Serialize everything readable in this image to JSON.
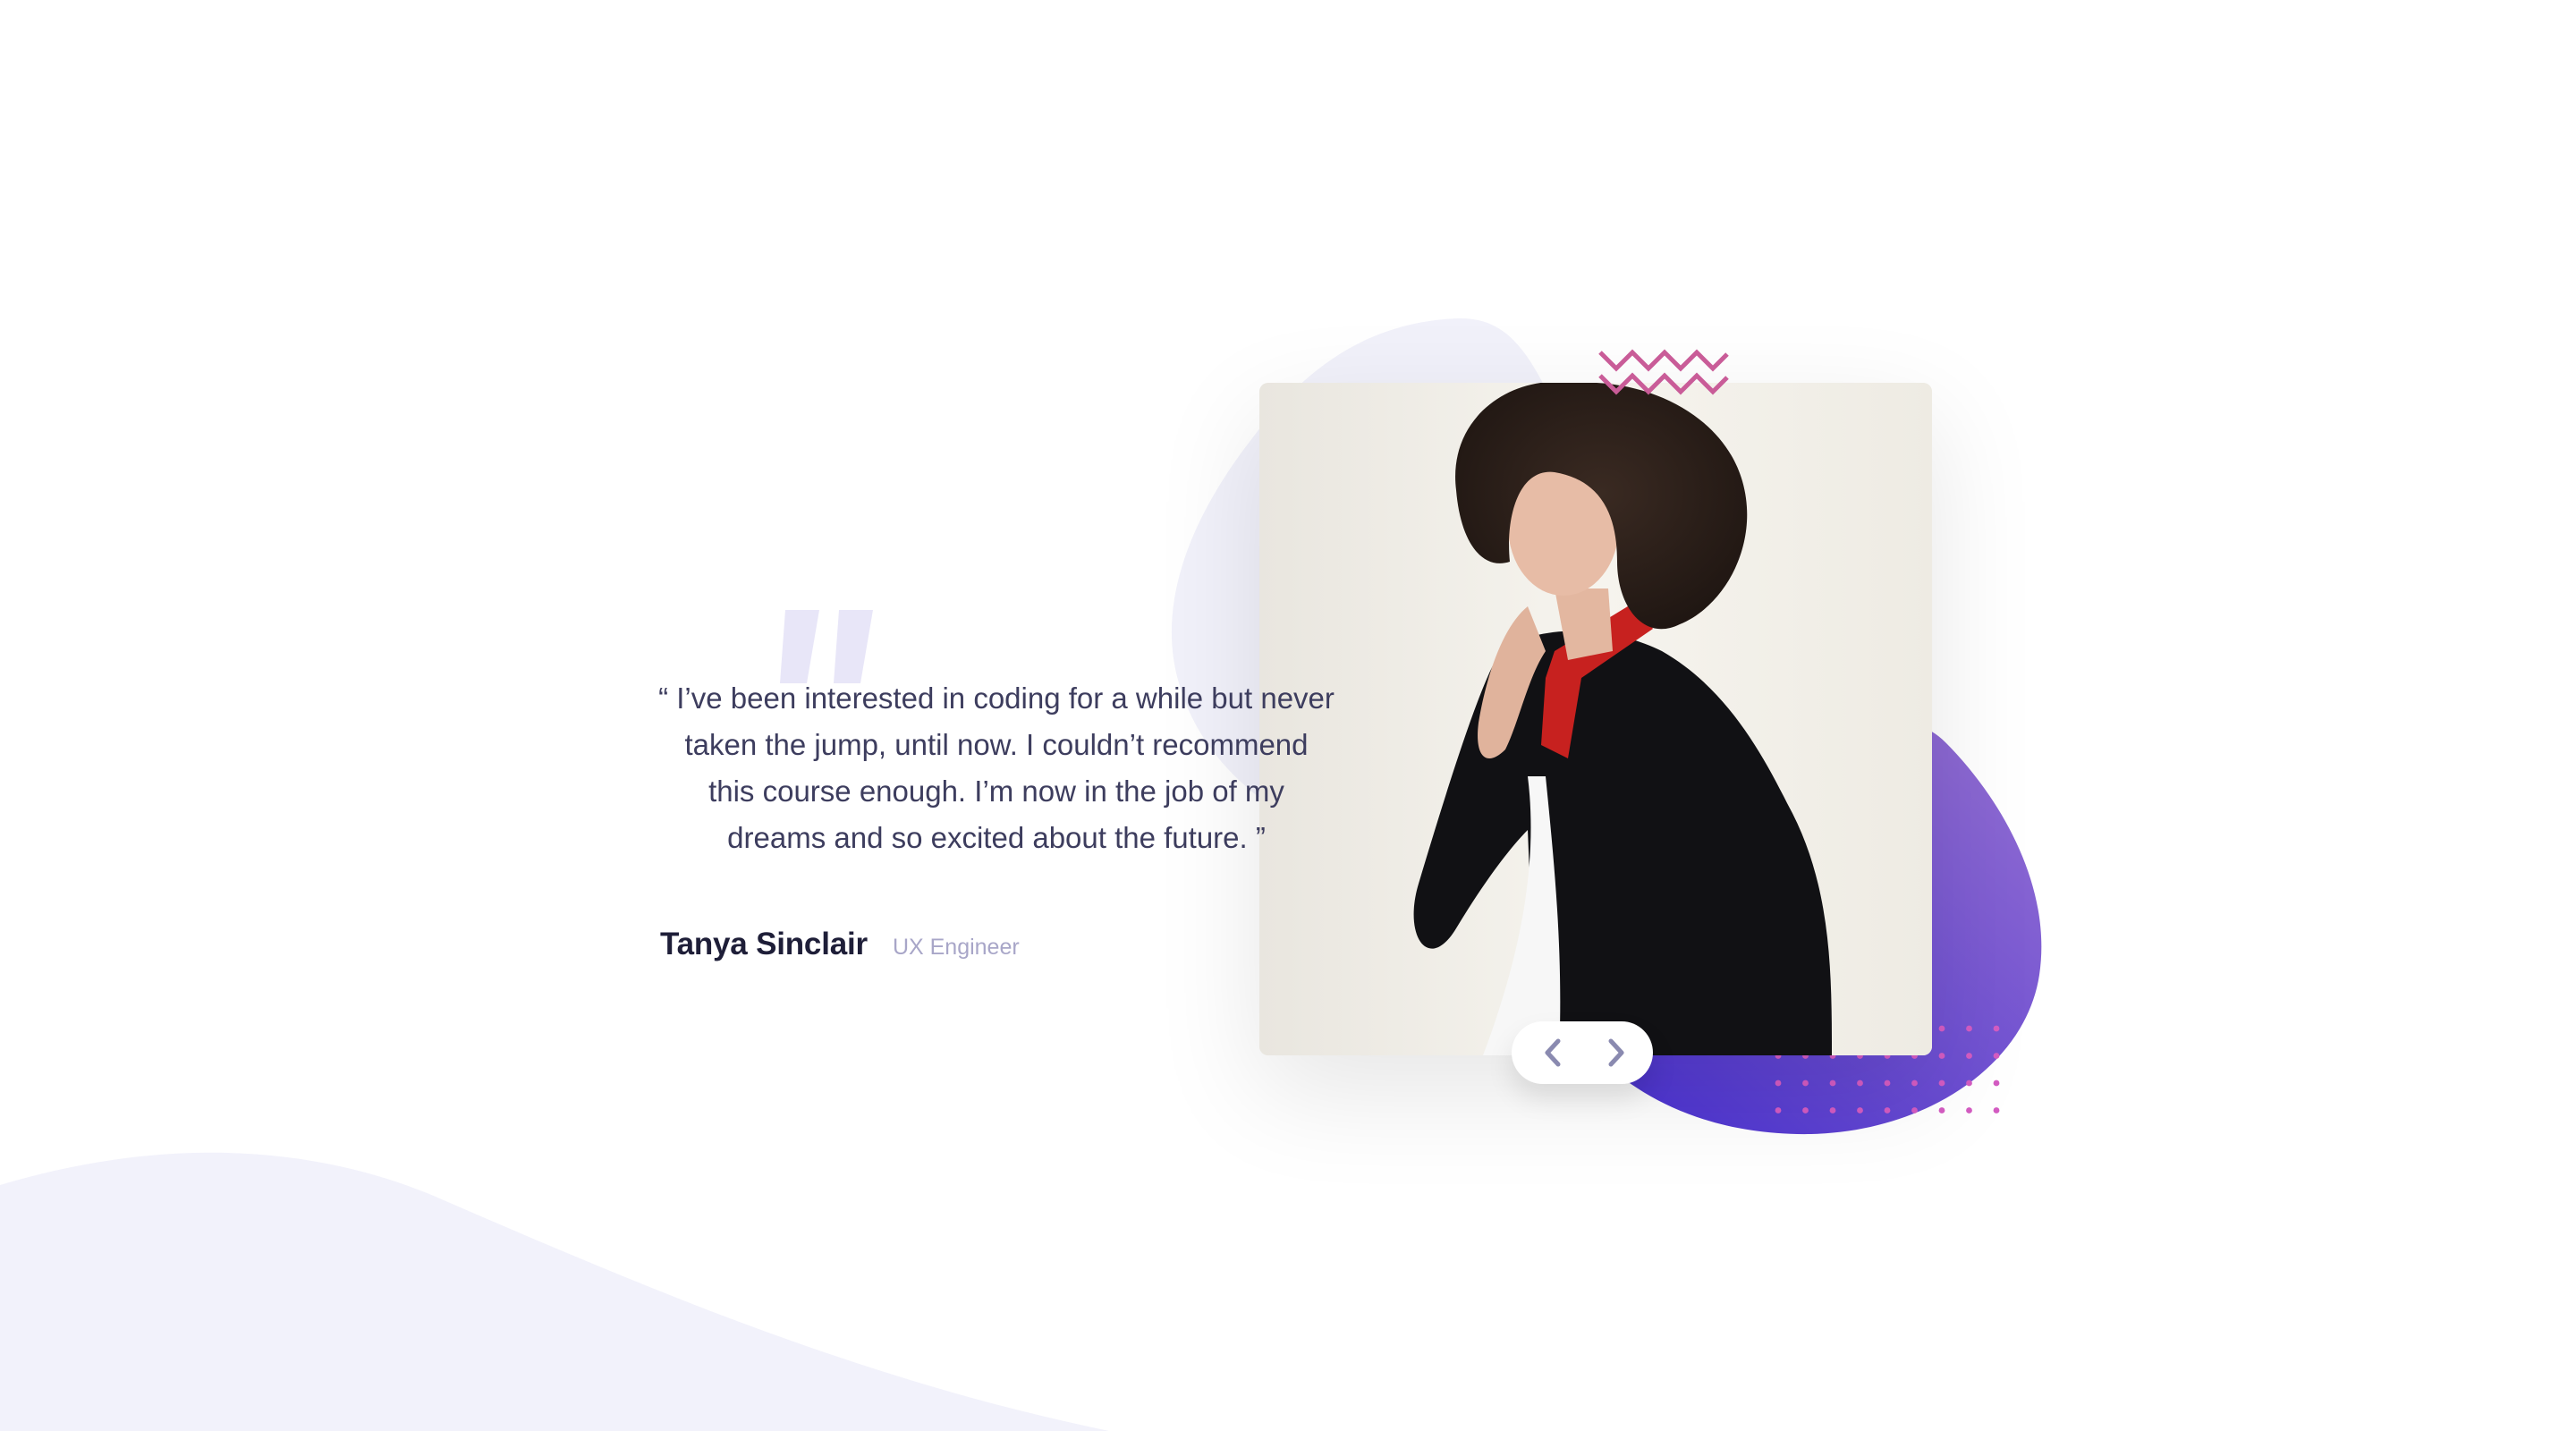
{
  "testimonial": {
    "quote": "“ I’ve been interested in coding for a while but never taken the jump, until now. I couldn’t recommend this course enough. I’m now in the job of my dreams and so excited about the future. ”",
    "author_name": "Tanya Sinclair",
    "author_role": "UX Engineer"
  },
  "navigation": {
    "prev_icon": "chevron-left-icon",
    "next_icon": "chevron-right-icon"
  },
  "colors": {
    "background": "#ffffff",
    "wave": "#f2f2fb",
    "accent_purple": "#6a4fd8",
    "zigzag": "#c95c98",
    "dots": "#d45cc2",
    "text_dark": "#1e1e38",
    "text_body": "#3d3d5e",
    "text_muted": "#a8a6c8"
  }
}
